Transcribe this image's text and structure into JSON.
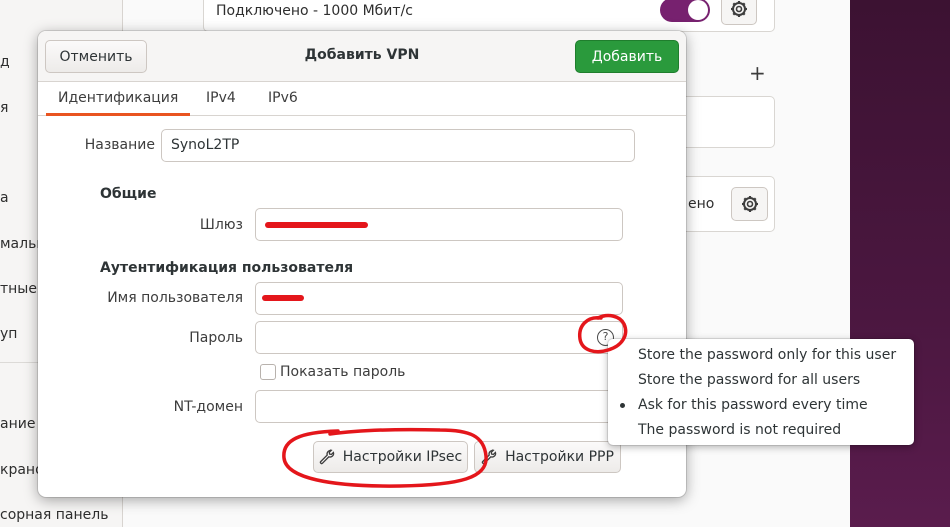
{
  "background": {
    "sidebar_fragments": [
      "д",
      "я",
      "а",
      "мальн",
      "тные",
      "уп",
      "ание",
      "крано",
      "сорная панель"
    ],
    "connected_text": "Подключено - 1000 Мбит/с",
    "vpn_status_fragment": "ено",
    "plus_label": "+"
  },
  "dialog": {
    "title": "Добавить VPN",
    "cancel_label": "Отменить",
    "add_label": "Добавить",
    "tabs": [
      {
        "label": "Идентификация",
        "active": true
      },
      {
        "label": "IPv4",
        "active": false
      },
      {
        "label": "IPv6",
        "active": false
      }
    ],
    "name_label": "Название",
    "name_value": "SynoL2TP",
    "general_heading": "Общие",
    "gateway_label": "Шлюз",
    "auth_heading": "Аутентификация пользователя",
    "username_label": "Имя пользователя",
    "password_label": "Пароль",
    "password_value": "",
    "show_password_label": "Показать пароль",
    "show_password_checked": false,
    "ntdomain_label": "NT-домен",
    "ntdomain_value": "",
    "ipsec_button": "Настройки IPsec",
    "ppp_button": "Настройки PPP"
  },
  "password_menu": {
    "items": [
      {
        "label": "Store the password only for this user",
        "selected": false
      },
      {
        "label": "Store the password for all users",
        "selected": false
      },
      {
        "label": "Ask for this password every time",
        "selected": true
      },
      {
        "label": "The password is not required",
        "selected": false
      }
    ]
  },
  "colors": {
    "accent_orange": "#e95420",
    "add_button_green": "#2a9a3c",
    "annotation_red": "#e4161b",
    "toggle_purple": "#77216f"
  }
}
